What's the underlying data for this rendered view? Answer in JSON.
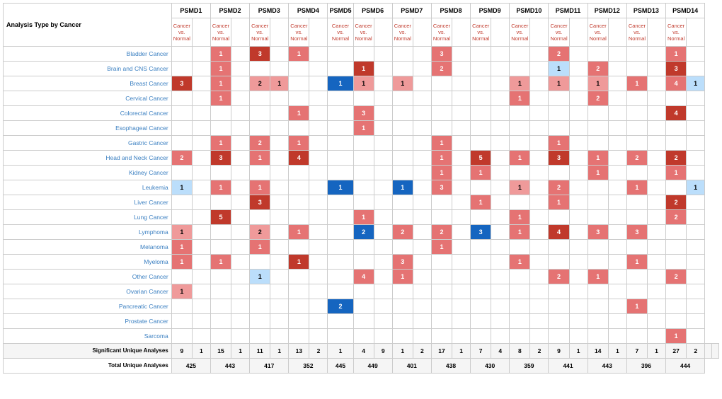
{
  "title": "Analysis Type by Cancer",
  "columns": [
    "PSMD1",
    "PSMD2",
    "PSMD3",
    "PSMD4",
    "PSMD5",
    "PSMD6",
    "PSMD7",
    "PSMD8",
    "PSMD9",
    "PSMD10",
    "PSMD11",
    "PSMD12",
    "PSMD13",
    "PSMD14"
  ],
  "subheader": "Cancer vs. Normal",
  "rows": [
    {
      "label": "Bladder Cancer",
      "cells": [
        [
          "",
          ""
        ],
        [
          "1",
          "r"
        ],
        [
          "3",
          "rd"
        ],
        [
          "1",
          "r"
        ],
        [
          "",
          ""
        ],
        [
          "",
          ""
        ],
        [
          "",
          ""
        ],
        [
          "3",
          "r"
        ],
        [
          "",
          ""
        ],
        [
          "",
          ""
        ],
        [
          "2",
          "r"
        ],
        [
          "",
          ""
        ],
        [
          "",
          ""
        ],
        [
          "1",
          "r"
        ]
      ]
    },
    {
      "label": "Brain and CNS Cancer",
      "cells": [
        [
          "",
          ""
        ],
        [
          "1",
          "r"
        ],
        [
          "",
          ""
        ],
        [
          "",
          ""
        ],
        [
          "",
          ""
        ],
        [
          "1",
          "rd"
        ],
        [
          "",
          ""
        ],
        [
          "2",
          "r"
        ],
        [
          "",
          ""
        ],
        [
          "",
          ""
        ],
        [
          "1",
          "bl"
        ],
        [
          "2",
          "r"
        ],
        [
          "",
          ""
        ],
        [
          "3",
          "rd"
        ]
      ]
    },
    {
      "label": "Breast Cancer",
      "cells": [
        [
          "3",
          "rd"
        ],
        [
          "1",
          "r"
        ],
        [
          "2",
          "rl"
        ],
        [
          "1",
          "rl"
        ],
        [
          "1",
          "bl"
        ],
        [
          "1",
          "rl"
        ],
        [
          "1",
          "rl"
        ],
        [
          "",
          ""
        ],
        [
          "",
          ""
        ],
        [
          "1",
          "rl"
        ],
        [
          "1",
          "rl"
        ],
        [
          "1",
          "rl"
        ],
        [
          "1",
          "r"
        ],
        [
          "4",
          "r"
        ],
        [
          "1",
          "bl"
        ]
      ]
    },
    {
      "label": "Cervical Cancer",
      "cells": [
        [
          "",
          ""
        ],
        [
          "1",
          "r"
        ],
        [
          "",
          ""
        ],
        [
          "",
          ""
        ],
        [
          "",
          ""
        ],
        [
          "",
          ""
        ],
        [
          "",
          ""
        ],
        [
          "",
          ""
        ],
        [
          "",
          ""
        ],
        [
          "1",
          "r"
        ],
        [
          "",
          ""
        ],
        [
          "2",
          "r"
        ],
        [
          "",
          ""
        ],
        [
          "",
          ""
        ],
        [
          "",
          ""
        ]
      ]
    },
    {
      "label": "Colorectal Cancer",
      "cells": [
        [
          "",
          ""
        ],
        [
          "",
          ""
        ],
        [
          "",
          ""
        ],
        [
          "1",
          "r"
        ],
        [
          "",
          ""
        ],
        [
          "3",
          "r"
        ],
        [
          "",
          ""
        ],
        [
          "",
          ""
        ],
        [
          "",
          ""
        ],
        [
          "",
          ""
        ],
        [
          "",
          ""
        ],
        [
          "",
          ""
        ],
        [
          "",
          ""
        ],
        [
          "4",
          "rd"
        ]
      ]
    },
    {
      "label": "Esophageal Cancer",
      "cells": [
        [
          "",
          ""
        ],
        [
          "",
          ""
        ],
        [
          "",
          ""
        ],
        [
          "",
          ""
        ],
        [
          "",
          ""
        ],
        [
          "1",
          "r"
        ],
        [
          "",
          ""
        ],
        [
          "",
          ""
        ],
        [
          "",
          ""
        ],
        [
          "",
          ""
        ],
        [
          "",
          ""
        ],
        [
          "",
          ""
        ],
        [
          "",
          ""
        ],
        [
          "",
          ""
        ]
      ]
    },
    {
      "label": "Gastric Cancer",
      "cells": [
        [
          "",
          ""
        ],
        [
          "1",
          "r"
        ],
        [
          "2",
          "r"
        ],
        [
          "1",
          "r"
        ],
        [
          "",
          ""
        ],
        [
          "",
          ""
        ],
        [
          "",
          ""
        ],
        [
          "1",
          "r"
        ],
        [
          "",
          ""
        ],
        [
          "",
          ""
        ],
        [
          "1",
          "r"
        ],
        [
          "",
          ""
        ],
        [
          "",
          ""
        ],
        [
          "",
          ""
        ]
      ]
    },
    {
      "label": "Head and Neck Cancer",
      "cells": [
        [
          "2",
          "r"
        ],
        [
          "3",
          "rd"
        ],
        [
          "1",
          "r"
        ],
        [
          "4",
          "rd"
        ],
        [
          "",
          ""
        ],
        [
          "",
          ""
        ],
        [
          "",
          ""
        ],
        [
          "1",
          "r"
        ],
        [
          "5",
          "rd"
        ],
        [
          "1",
          "r"
        ],
        [
          "3",
          "rd"
        ],
        [
          "1",
          "r"
        ],
        [
          "2",
          "r"
        ],
        [
          "2",
          "rd"
        ]
      ]
    },
    {
      "label": "Kidney Cancer",
      "cells": [
        [
          "",
          ""
        ],
        [
          "",
          ""
        ],
        [
          "",
          ""
        ],
        [
          "",
          ""
        ],
        [
          "",
          ""
        ],
        [
          "",
          ""
        ],
        [
          "",
          ""
        ],
        [
          "1",
          "r"
        ],
        [
          "1",
          "r"
        ],
        [
          "",
          ""
        ],
        [
          "",
          ""
        ],
        [
          "1",
          "r"
        ],
        [
          "",
          ""
        ],
        [
          "1",
          "r"
        ]
      ]
    },
    {
      "label": "Leukemia",
      "cells": [
        [
          "1",
          "bl"
        ],
        [
          "1",
          "r"
        ],
        [
          "1",
          "r"
        ],
        [
          "",
          ""
        ],
        [
          "1",
          "bd"
        ],
        [
          "",
          ""
        ],
        [
          "1",
          "bd"
        ],
        [
          "3",
          "r"
        ],
        [
          "",
          ""
        ],
        [
          "1",
          "rl"
        ],
        [
          "2",
          "r"
        ],
        [
          "",
          ""
        ],
        [
          "1",
          "r"
        ],
        [
          "",
          ""
        ],
        [
          "1",
          "bl"
        ]
      ]
    },
    {
      "label": "Liver Cancer",
      "cells": [
        [
          "",
          ""
        ],
        [
          "",
          ""
        ],
        [
          "3",
          "rd"
        ],
        [
          "",
          ""
        ],
        [
          "",
          ""
        ],
        [
          "",
          ""
        ],
        [
          "",
          ""
        ],
        [
          "",
          ""
        ],
        [
          "1",
          "r"
        ],
        [
          "",
          ""
        ],
        [
          "",
          ""
        ],
        [
          "",
          ""
        ],
        [
          "2",
          "rd"
        ],
        [
          "",
          ""
        ]
      ]
    },
    {
      "label": "Lung Cancer",
      "cells": [
        [
          "",
          ""
        ],
        [
          "5",
          "rd"
        ],
        [
          "",
          ""
        ],
        [
          "",
          ""
        ],
        [
          "",
          ""
        ],
        [
          "1",
          "r"
        ],
        [
          "",
          ""
        ],
        [
          "",
          ""
        ],
        [
          "",
          ""
        ],
        [
          "1",
          "r"
        ],
        [
          "",
          ""
        ],
        [
          "",
          ""
        ],
        [
          "2",
          "r"
        ],
        [
          "",
          ""
        ]
      ]
    },
    {
      "label": "Lymphoma",
      "cells": [
        [
          "1",
          "rl"
        ],
        [
          "",
          ""
        ],
        [
          "2",
          "rl"
        ],
        [
          "1",
          "r"
        ],
        [
          "",
          ""
        ],
        [
          "2",
          "bd"
        ],
        [
          "2",
          "r"
        ],
        [
          "2",
          "r"
        ],
        [
          "3",
          "bd"
        ],
        [
          "1",
          "r"
        ],
        [
          "4",
          "rd"
        ],
        [
          "3",
          "r"
        ],
        [
          "3",
          "r"
        ],
        [
          "",
          ""
        ]
      ]
    },
    {
      "label": "Melanoma",
      "cells": [
        [
          "1",
          "r"
        ],
        [
          "",
          ""
        ],
        [
          "1",
          "r"
        ],
        [
          "",
          ""
        ],
        [
          "",
          ""
        ],
        [
          "",
          ""
        ],
        [
          "",
          ""
        ],
        [
          "1",
          "r"
        ],
        [
          "",
          ""
        ],
        [
          "",
          ""
        ],
        [
          "",
          ""
        ],
        [
          "",
          ""
        ],
        [
          "",
          ""
        ],
        [
          "",
          ""
        ]
      ]
    },
    {
      "label": "Myeloma",
      "cells": [
        [
          "1",
          "r"
        ],
        [
          "1",
          "r"
        ],
        [
          "",
          ""
        ],
        [
          "1",
          "rd"
        ],
        [
          "",
          ""
        ],
        [
          "",
          ""
        ],
        [
          "3",
          "r"
        ],
        [
          "",
          ""
        ],
        [
          "",
          ""
        ],
        [
          "1",
          "r"
        ],
        [
          "",
          ""
        ],
        [
          "",
          ""
        ],
        [
          "1",
          "r"
        ],
        [
          "",
          ""
        ]
      ]
    },
    {
      "label": "Other Cancer",
      "cells": [
        [
          "",
          ""
        ],
        [
          "",
          ""
        ],
        [
          "1",
          "bl"
        ],
        [
          "",
          ""
        ],
        [
          "",
          ""
        ],
        [
          "4",
          "r"
        ],
        [
          "1",
          "r"
        ],
        [
          "",
          ""
        ],
        [
          "",
          ""
        ],
        [
          "",
          ""
        ],
        [
          "2",
          "r"
        ],
        [
          "1",
          "r"
        ],
        [
          "",
          ""
        ],
        [
          "2",
          "r"
        ]
      ]
    },
    {
      "label": "Ovarian Cancer",
      "cells": [
        [
          "1",
          "rl"
        ],
        [
          "",
          ""
        ],
        [
          "",
          ""
        ],
        [
          "",
          ""
        ],
        [
          "",
          ""
        ],
        [
          "",
          ""
        ],
        [
          "",
          ""
        ],
        [
          "",
          ""
        ],
        [
          "",
          ""
        ],
        [
          "",
          ""
        ],
        [
          "",
          ""
        ],
        [
          "",
          ""
        ],
        [
          "",
          ""
        ],
        [
          "",
          ""
        ]
      ]
    },
    {
      "label": "Pancreatic Cancer",
      "cells": [
        [
          "",
          ""
        ],
        [
          "",
          ""
        ],
        [
          "",
          ""
        ],
        [
          "",
          ""
        ],
        [
          "2",
          "bd"
        ],
        [
          "",
          ""
        ],
        [
          "",
          ""
        ],
        [
          "",
          ""
        ],
        [
          "",
          ""
        ],
        [
          "",
          ""
        ],
        [
          "",
          ""
        ],
        [
          "",
          ""
        ],
        [
          "1",
          "r"
        ],
        [
          "",
          ""
        ]
      ]
    },
    {
      "label": "Prostate Cancer",
      "cells": [
        [
          "",
          ""
        ],
        [
          "",
          ""
        ],
        [
          "",
          ""
        ],
        [
          "",
          ""
        ],
        [
          "",
          ""
        ],
        [
          "",
          ""
        ],
        [
          "",
          ""
        ],
        [
          "",
          ""
        ],
        [
          "",
          ""
        ],
        [
          "",
          ""
        ],
        [
          "",
          ""
        ],
        [
          "",
          ""
        ],
        [
          "",
          ""
        ],
        [
          "",
          ""
        ]
      ]
    },
    {
      "label": "Sarcoma",
      "cells": [
        [
          "",
          ""
        ],
        [
          "",
          ""
        ],
        [
          "",
          ""
        ],
        [
          "",
          ""
        ],
        [
          "",
          ""
        ],
        [
          "",
          ""
        ],
        [
          "",
          ""
        ],
        [
          "",
          ""
        ],
        [
          "",
          ""
        ],
        [
          "",
          ""
        ],
        [
          "",
          ""
        ],
        [
          "",
          ""
        ],
        [
          "",
          ""
        ],
        [
          "1",
          "r"
        ]
      ]
    }
  ],
  "significant": {
    "label": "Significant Unique Analyses",
    "values": [
      "9",
      "1",
      "15",
      "1",
      "11",
      "1",
      "13",
      "2",
      "1",
      "4",
      "9",
      "1",
      "2",
      "17",
      "1",
      "7",
      "4",
      "8",
      "2",
      "9",
      "1",
      "14",
      "1",
      "7",
      "1",
      "27",
      "2"
    ]
  },
  "total": {
    "label": "Total Unique Analyses",
    "values": [
      "425",
      "443",
      "417",
      "352",
      "445",
      "449",
      "401",
      "438",
      "430",
      "359",
      "441",
      "443",
      "396",
      "444"
    ]
  }
}
